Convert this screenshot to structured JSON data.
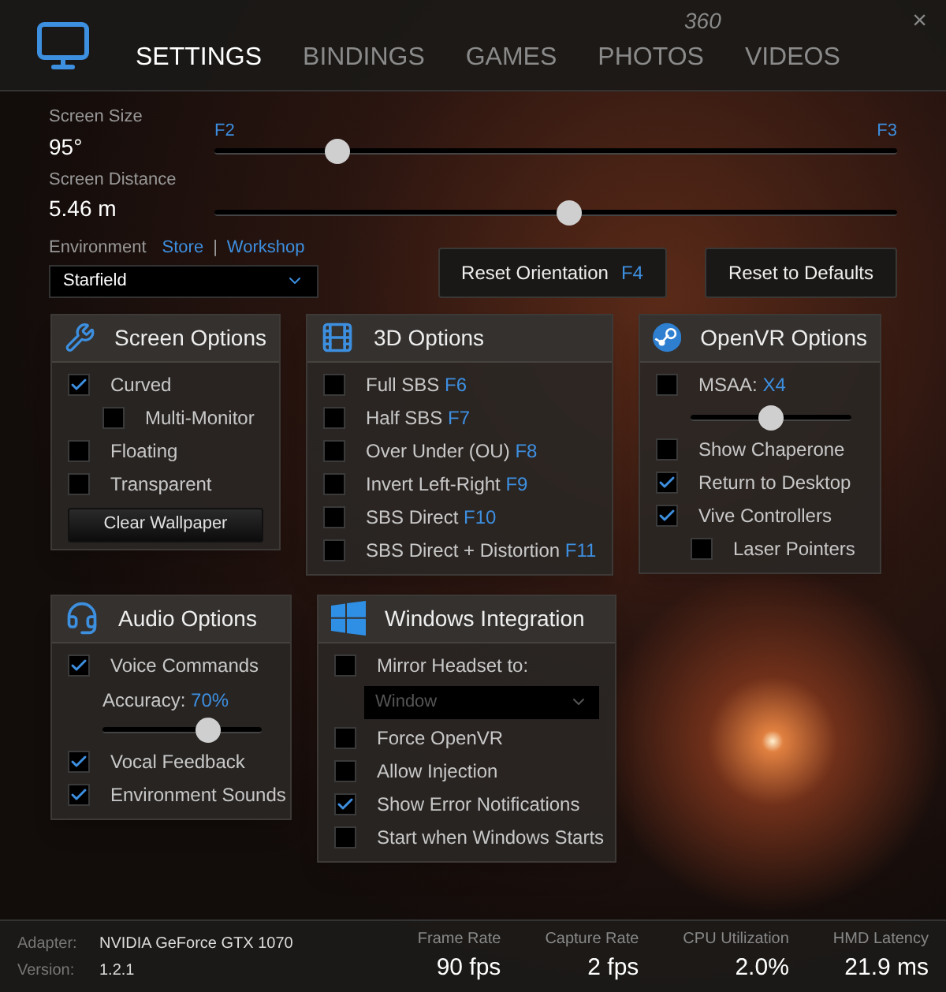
{
  "header": {
    "overline": "360",
    "close": "×"
  },
  "tabs": [
    {
      "label": "SETTINGS",
      "selected": true
    },
    {
      "label": "BINDINGS",
      "selected": false
    },
    {
      "label": "GAMES",
      "selected": false
    },
    {
      "label": "PHOTOS",
      "selected": false
    },
    {
      "label": "VIDEOS",
      "selected": false
    }
  ],
  "sliders": [
    {
      "label": "Screen Size",
      "value": "95°",
      "level": 0.18,
      "left_key": "F2",
      "right_key": "F3"
    },
    {
      "label": "Screen Distance",
      "value": "5.46 m",
      "level": 0.52
    }
  ],
  "environment": {
    "label": "Environment",
    "links": [
      "Store",
      "Workshop"
    ],
    "separator": "|",
    "value": "Starfield"
  },
  "buttons": [
    {
      "label": "Reset Orientation",
      "key": "F4"
    },
    {
      "label": "Reset to Defaults"
    }
  ],
  "panels": [
    {
      "title": "Screen Options",
      "items": [
        {
          "kind": "checkbox",
          "label": "Curved",
          "checked": true,
          "children": [
            {
              "kind": "checkbox",
              "label": "Multi-Monitor",
              "checked": false
            }
          ]
        },
        {
          "kind": "checkbox",
          "label": "Floating",
          "checked": false
        },
        {
          "kind": "checkbox",
          "label": "Transparent",
          "checked": false
        },
        {
          "kind": "button",
          "label": "Clear Wallpaper"
        }
      ]
    },
    {
      "title": "3D Options",
      "items": [
        {
          "kind": "checkbox",
          "label": "Full SBS",
          "key": "F6",
          "checked": false
        },
        {
          "kind": "checkbox",
          "label": "Half SBS",
          "key": "F7",
          "checked": false
        },
        {
          "kind": "checkbox",
          "label": "Over Under (OU)",
          "key": "F8",
          "checked": false
        },
        {
          "kind": "checkbox",
          "label": "Invert Left-Right",
          "key": "F9",
          "checked": false
        },
        {
          "kind": "checkbox",
          "label": "SBS Direct",
          "key": "F10",
          "checked": false
        },
        {
          "kind": "checkbox",
          "label": "SBS Direct + Distortion",
          "key": "F11",
          "checked": false
        }
      ]
    },
    {
      "title": "OpenVR Options",
      "items": [
        {
          "kind": "checkbox",
          "label": "MSAA:",
          "key": "X4",
          "checked": false
        },
        {
          "kind": "slider",
          "level": 0.5
        },
        {
          "kind": "checkbox",
          "label": "Show Chaperone",
          "checked": false
        },
        {
          "kind": "checkbox",
          "label": "Return to Desktop",
          "checked": true
        },
        {
          "kind": "checkbox",
          "label": "Vive Controllers",
          "checked": true,
          "children": [
            {
              "kind": "checkbox",
              "label": "Laser Pointers",
              "checked": false
            }
          ]
        }
      ]
    },
    {
      "title": "Audio Options",
      "items": [
        {
          "kind": "checkbox",
          "label": "Voice Commands",
          "checked": true
        },
        {
          "kind": "slider",
          "label": "Accuracy:",
          "key": "70%",
          "level": 0.66
        },
        {
          "kind": "checkbox",
          "label": "Vocal Feedback",
          "checked": true
        },
        {
          "kind": "checkbox",
          "label": "Environment Sounds",
          "checked": true
        }
      ]
    },
    {
      "title": "Windows Integration",
      "items": [
        {
          "kind": "checkbox",
          "label": "Mirror Headset to:",
          "checked": false
        },
        {
          "kind": "dropdown",
          "value": "Window",
          "disabled": true
        },
        {
          "kind": "checkbox",
          "label": "Force OpenVR",
          "checked": false
        },
        {
          "kind": "checkbox",
          "label": "Allow Injection",
          "checked": false
        },
        {
          "kind": "checkbox",
          "label": "Show Error Notifications",
          "checked": true
        },
        {
          "kind": "checkbox",
          "label": "Start when Windows Starts",
          "checked": false
        }
      ]
    }
  ],
  "status_bar": {
    "info": [
      {
        "label": "Adapter:",
        "value": "NVIDIA GeForce GTX 1070"
      },
      {
        "label": "Version:",
        "value": "1.2.1"
      }
    ],
    "stats": [
      {
        "label": "Frame Rate",
        "value": "90 fps"
      },
      {
        "label": "Capture Rate",
        "value": "2 fps"
      },
      {
        "label": "CPU Utilization",
        "value": "2.0%"
      },
      {
        "label": "HMD Latency",
        "value": "21.9 ms"
      }
    ]
  }
}
